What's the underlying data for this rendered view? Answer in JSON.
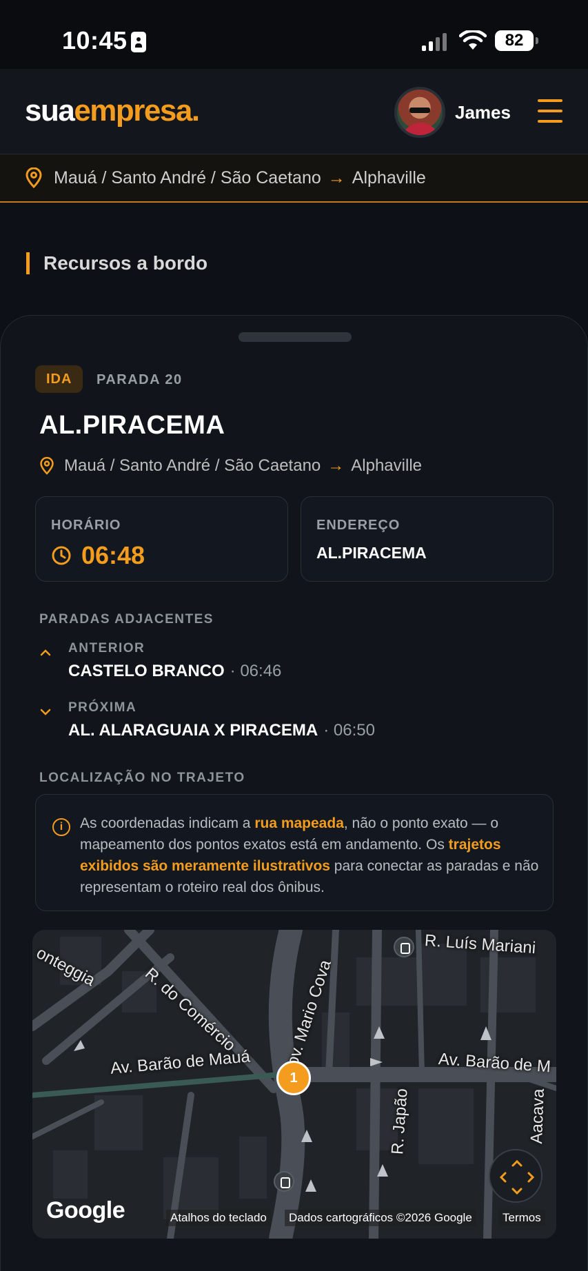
{
  "status_bar": {
    "time": "10:45",
    "battery": "82"
  },
  "header": {
    "logo_part1": "sua",
    "logo_part2": "empresa",
    "logo_dot": ".",
    "user_name": "James"
  },
  "route_strip": {
    "origin": "Mauá / Santo André / São Caetano",
    "arrow": "→",
    "destination": "Alphaville"
  },
  "section": {
    "title": "Recursos a bordo"
  },
  "stop": {
    "direction_badge": "IDA",
    "stop_number": "PARADA 20",
    "name": "AL.PIRACEMA",
    "route_origin": "Mauá / Santo André / São Caetano",
    "route_arrow": "→",
    "route_destination": "Alphaville",
    "time_label": "HORÁRIO",
    "time_value": "06:48",
    "address_label": "ENDEREÇO",
    "address_value": "AL.PIRACEMA"
  },
  "adjacent": {
    "heading": "PARADAS ADJACENTES",
    "previous_label": "ANTERIOR",
    "previous_name": "CASTELO BRANCO",
    "previous_time": "· 06:46",
    "next_label": "PRÓXIMA",
    "next_name": "AL. ALARAGUAIA X PIRACEMA",
    "next_time": "· 06:50"
  },
  "location": {
    "heading": "LOCALIZAÇÃO NO TRAJETO",
    "notice_1": "As coordenadas indicam a ",
    "notice_highlight_1": "rua mapeada",
    "notice_2": ", não o ponto exato — o mapeamento dos pontos exatos está em andamento. Os ",
    "notice_highlight_2": "trajetos exibidos são meramente ilustrativos",
    "notice_3": " para conectar as paradas e não representam o roteiro real dos ônibus."
  },
  "map": {
    "street_1": "onteggia",
    "street_2": "R. do Comércio",
    "street_3": "Gov. Mario Cova",
    "street_4": "R. Luís Mariani",
    "street_5": "Av. Barão de Mauá",
    "street_6": "Av. Barão de M",
    "street_7": "R. Japão",
    "street_8": "Aacava",
    "marker_label": "1",
    "google": "Google",
    "footer_shortcuts": "Atalhos do teclado",
    "footer_data": "Dados cartográficos ©2026 Google",
    "footer_terms": "Termos"
  },
  "colors": {
    "accent": "#f39c1e",
    "background": "#0d1016",
    "card": "#131820"
  }
}
